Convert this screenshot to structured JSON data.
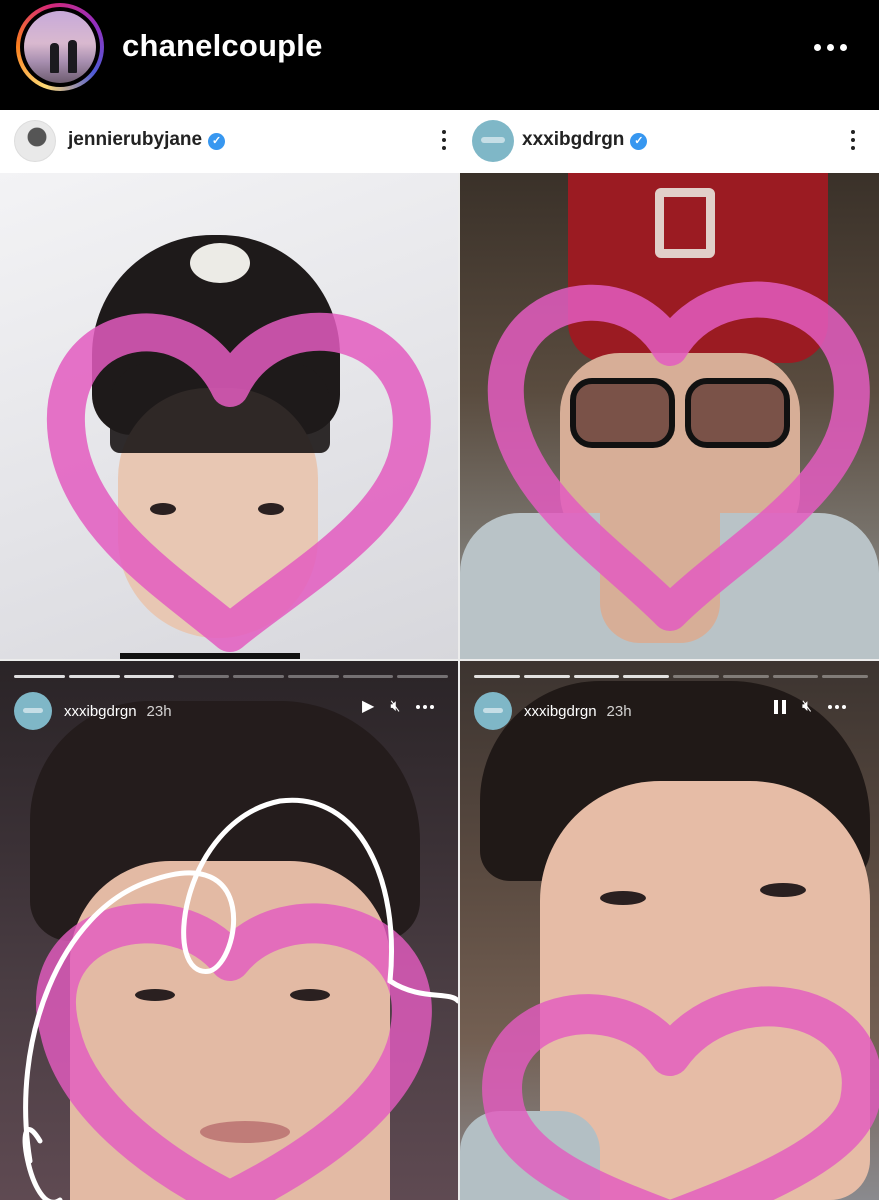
{
  "header": {
    "username": "chanelcouple",
    "avatar_icon": "profile-avatar",
    "more_icon": "more-horizontal-icon"
  },
  "posts": {
    "left": {
      "username": "jennierubyjane",
      "verified": true,
      "more_icon": "more-vertical-icon"
    },
    "right": {
      "username": "xxxibgdrgn",
      "verified": true,
      "more_icon": "more-vertical-icon"
    }
  },
  "stories": {
    "left": {
      "username": "xxxibgdrgn",
      "time": "23h",
      "state": "paused",
      "icons": [
        "play-icon",
        "mute-icon",
        "more-horizontal-icon"
      ]
    },
    "right": {
      "username": "xxxibgdrgn",
      "time": "23h",
      "state": "playing",
      "icons": [
        "pause-icon",
        "mute-icon",
        "more-horizontal-icon"
      ]
    }
  },
  "colors": {
    "heart_pink": "#e35cc0",
    "verified_blue": "#3797f0",
    "cap_red": "#9b1b22"
  }
}
